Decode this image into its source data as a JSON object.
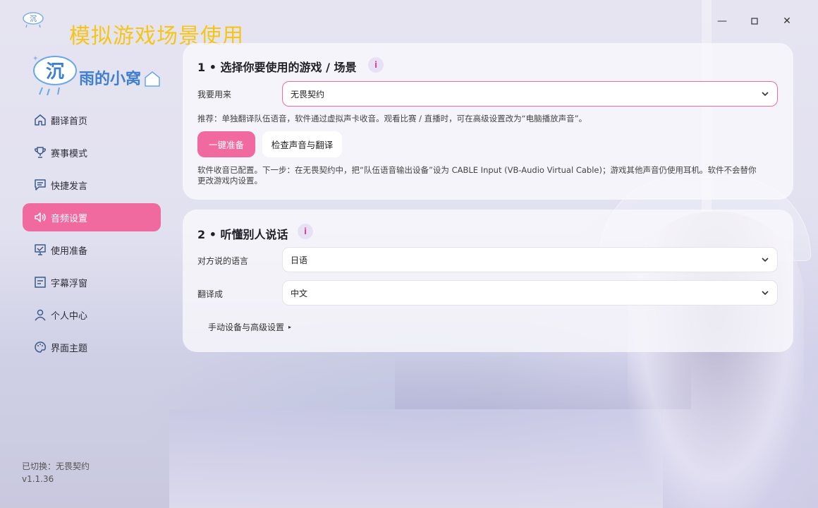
{
  "window": {
    "title": "模拟游戏场景使用",
    "controls": {
      "minimize": "—",
      "maximize": "□",
      "close": "✕"
    }
  },
  "sidebar": {
    "logo_text": "沉雨的小窝",
    "items": [
      {
        "label": "翻译首页",
        "icon": "home-icon",
        "active": false
      },
      {
        "label": "赛事模式",
        "icon": "trophy-icon",
        "active": false
      },
      {
        "label": "快捷发言",
        "icon": "chat-icon",
        "active": false
      },
      {
        "label": "音频设置",
        "icon": "speaker-icon",
        "active": true
      },
      {
        "label": "使用准备",
        "icon": "monitor-check-icon",
        "active": false
      },
      {
        "label": "字幕浮窗",
        "icon": "subtitle-icon",
        "active": false
      },
      {
        "label": "个人中心",
        "icon": "user-icon",
        "active": false
      },
      {
        "label": "界面主题",
        "icon": "palette-icon",
        "active": false
      }
    ],
    "status": "已切换：无畏契约",
    "version": "v1.1.36"
  },
  "section1": {
    "title": "1 • 选择你要使用的游戏 / 场景",
    "info": "i",
    "use_label": "我要用来",
    "use_value": "无畏契约",
    "recommend": "推荐：单独翻译队伍语音，软件通过虚拟声卡收音。观看比赛 / 直播时，可在高级设置改为“电脑播放声音”。",
    "primary_button": "一键准备",
    "secondary_button": "检查声音与翻译",
    "status_line1": "软件收音已配置。下一步：在无畏契约中，把“队伍语音输出设备”设为 CABLE Input (VB-Audio Virtual Cable)；游戏其他声音仍使用耳机。软件不会替你",
    "status_line2": "更改游戏内设置。"
  },
  "section2": {
    "title": "2 • 听懂别人说话",
    "info": "i",
    "source_label": "对方说的语言",
    "source_value": "日语",
    "target_label": "翻译成",
    "target_value": "中文",
    "advanced_link": "手动设备与高级设置",
    "advanced_arrow": "▸"
  },
  "colors": {
    "accent": "#f06aa0",
    "title_yellow": "#f5c518"
  }
}
